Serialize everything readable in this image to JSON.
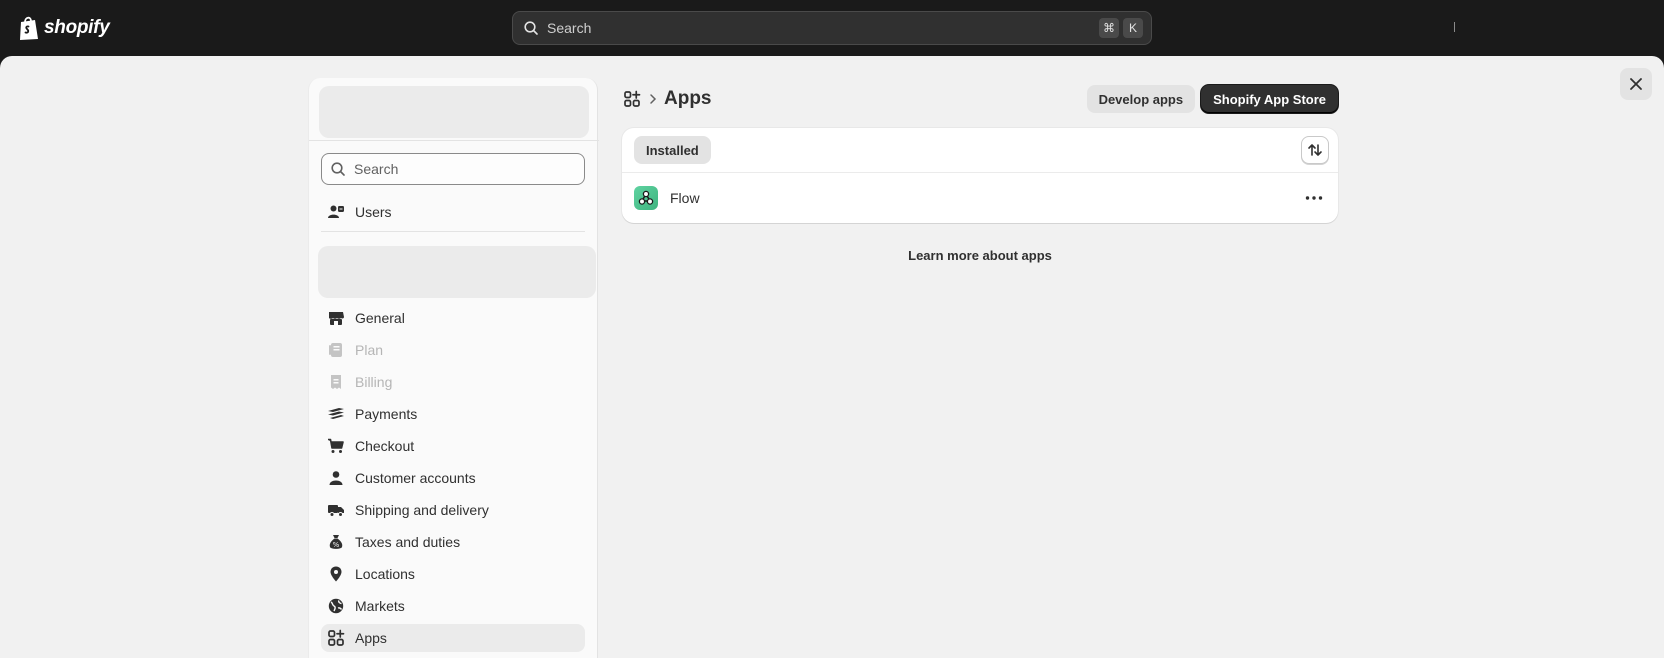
{
  "topbar": {
    "brand": "shopify",
    "search_placeholder": "Search",
    "shortcut_keys": [
      "⌘",
      "K"
    ]
  },
  "sidebar": {
    "search_placeholder": "Search",
    "users_label": "Users",
    "items": [
      {
        "label": "General",
        "icon": "store-icon",
        "disabled": false
      },
      {
        "label": "Plan",
        "icon": "plan-icon",
        "disabled": true
      },
      {
        "label": "Billing",
        "icon": "billing-icon",
        "disabled": true
      },
      {
        "label": "Payments",
        "icon": "payments-icon",
        "disabled": false
      },
      {
        "label": "Checkout",
        "icon": "cart-icon",
        "disabled": false
      },
      {
        "label": "Customer accounts",
        "icon": "person-icon",
        "disabled": false
      },
      {
        "label": "Shipping and delivery",
        "icon": "truck-icon",
        "disabled": false
      },
      {
        "label": "Taxes and duties",
        "icon": "tax-icon",
        "disabled": false
      },
      {
        "label": "Locations",
        "icon": "location-icon",
        "disabled": false
      },
      {
        "label": "Markets",
        "icon": "globe-icon",
        "disabled": false
      },
      {
        "label": "Apps",
        "icon": "apps-icon",
        "disabled": false,
        "active": true
      }
    ]
  },
  "main": {
    "title": "Apps",
    "actions": {
      "develop_apps": "Develop apps",
      "app_store": "Shopify App Store"
    },
    "tabs": [
      {
        "label": "Installed",
        "selected": true
      }
    ],
    "apps": [
      {
        "name": "Flow",
        "icon": "flow-app-icon"
      }
    ],
    "learn_more": "Learn more about apps"
  },
  "colors": {
    "topbar_bg": "#1a1a1a",
    "surface_bg": "#f1f1f1",
    "primary_button": "#303030",
    "flow_icon": "#3fb47f"
  }
}
